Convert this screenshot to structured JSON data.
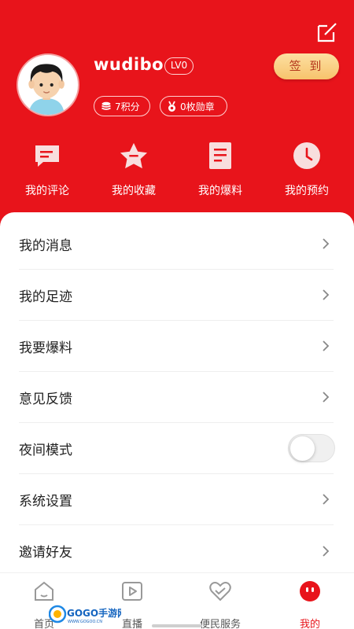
{
  "colors": {
    "primary": "#e8141b",
    "sign_in_text": "#b4361c",
    "sign_in_bg": "#f7c36c"
  },
  "header": {
    "edit_icon": "edit-icon",
    "username": "wudibo",
    "level": "LV0",
    "sign_in_label": "签 到",
    "points_label": "7积分",
    "medals_label": "0枚勋章"
  },
  "quick_actions": [
    {
      "label": "我的评论",
      "icon": "comment-icon"
    },
    {
      "label": "我的收藏",
      "icon": "star-icon"
    },
    {
      "label": "我的爆料",
      "icon": "document-icon"
    },
    {
      "label": "我的预约",
      "icon": "clock-icon"
    }
  ],
  "menu": [
    {
      "label": "我的消息",
      "type": "link"
    },
    {
      "label": "我的足迹",
      "type": "link"
    },
    {
      "label": "我要爆料",
      "type": "link"
    },
    {
      "label": "意见反馈",
      "type": "link"
    },
    {
      "label": "夜间模式",
      "type": "toggle",
      "checked": false
    },
    {
      "label": "系统设置",
      "type": "link"
    },
    {
      "label": "邀请好友",
      "type": "link"
    }
  ],
  "tabs": [
    {
      "label": "首页",
      "icon": "home-icon",
      "active": false
    },
    {
      "label": "直播",
      "icon": "play-icon",
      "active": false
    },
    {
      "label": "便民服务",
      "icon": "heart-hands-icon",
      "active": false
    },
    {
      "label": "我的",
      "icon": "profile-icon",
      "active": true
    }
  ],
  "watermark": {
    "text": "GOGO手游网",
    "sub": "WWW.GOGOO.CN"
  }
}
